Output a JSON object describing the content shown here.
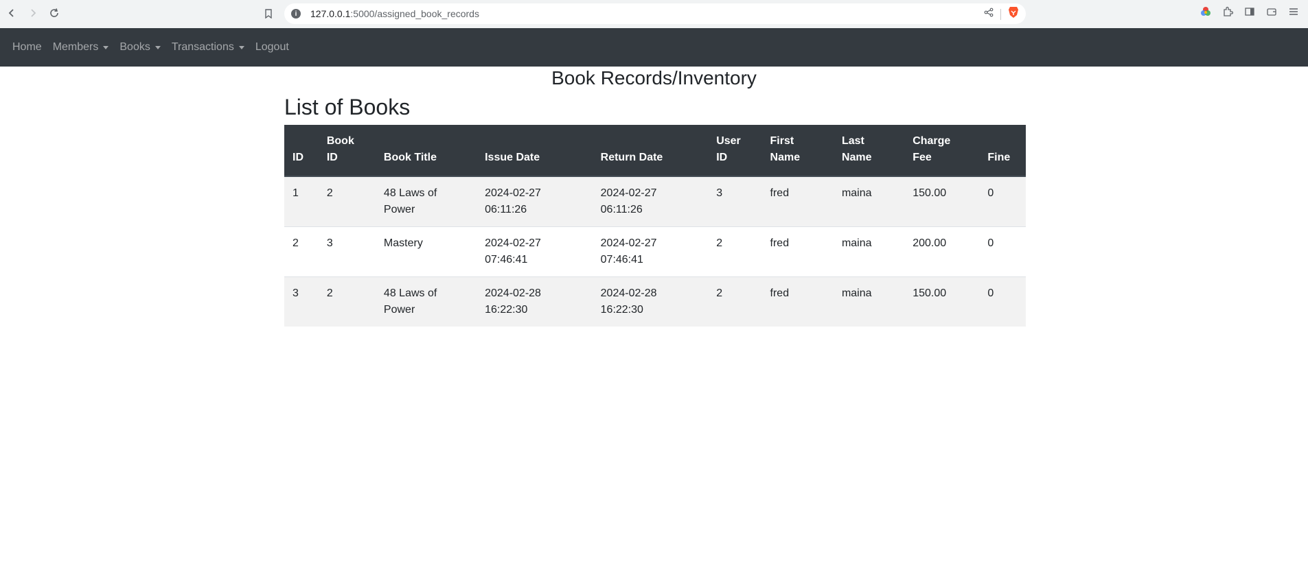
{
  "browser": {
    "url_host": "127.0.0.1",
    "url_path": ":5000/assigned_book_records"
  },
  "navbar": {
    "home": "Home",
    "members": "Members",
    "books": "Books",
    "transactions": "Transactions",
    "logout": "Logout"
  },
  "page": {
    "heading": "Book Records/Inventory",
    "list_heading": "List of Books"
  },
  "table": {
    "headers": [
      "ID",
      "Book ID",
      "Book Title",
      "Issue Date",
      "Return Date",
      "User ID",
      "First Name",
      "Last Name",
      "Charge Fee",
      "Fine"
    ],
    "rows": [
      [
        "1",
        "2",
        "48 Laws of Power",
        "2024-02-27 06:11:26",
        "2024-02-27 06:11:26",
        "3",
        "fred",
        "maina",
        "150.00",
        "0"
      ],
      [
        "2",
        "3",
        "Mastery",
        "2024-02-27 07:46:41",
        "2024-02-27 07:46:41",
        "2",
        "fred",
        "maina",
        "200.00",
        "0"
      ],
      [
        "3",
        "2",
        "48 Laws of Power",
        "2024-02-28 16:22:30",
        "2024-02-28 16:22:30",
        "2",
        "fred",
        "maina",
        "150.00",
        "0"
      ]
    ]
  },
  "colors": {
    "navbar_bg": "#343a40",
    "header_bg": "#343a40",
    "stripe_bg": "#f2f2f2",
    "brave_orange": "#fb542b"
  },
  "icons": [
    "back-arrow-icon",
    "forward-arrow-icon",
    "reload-icon",
    "bookmark-icon",
    "site-info-icon",
    "share-icon",
    "brave-lion-icon",
    "rewards-icon",
    "extensions-icon",
    "sidebar-icon",
    "wallet-icon",
    "menu-icon"
  ]
}
